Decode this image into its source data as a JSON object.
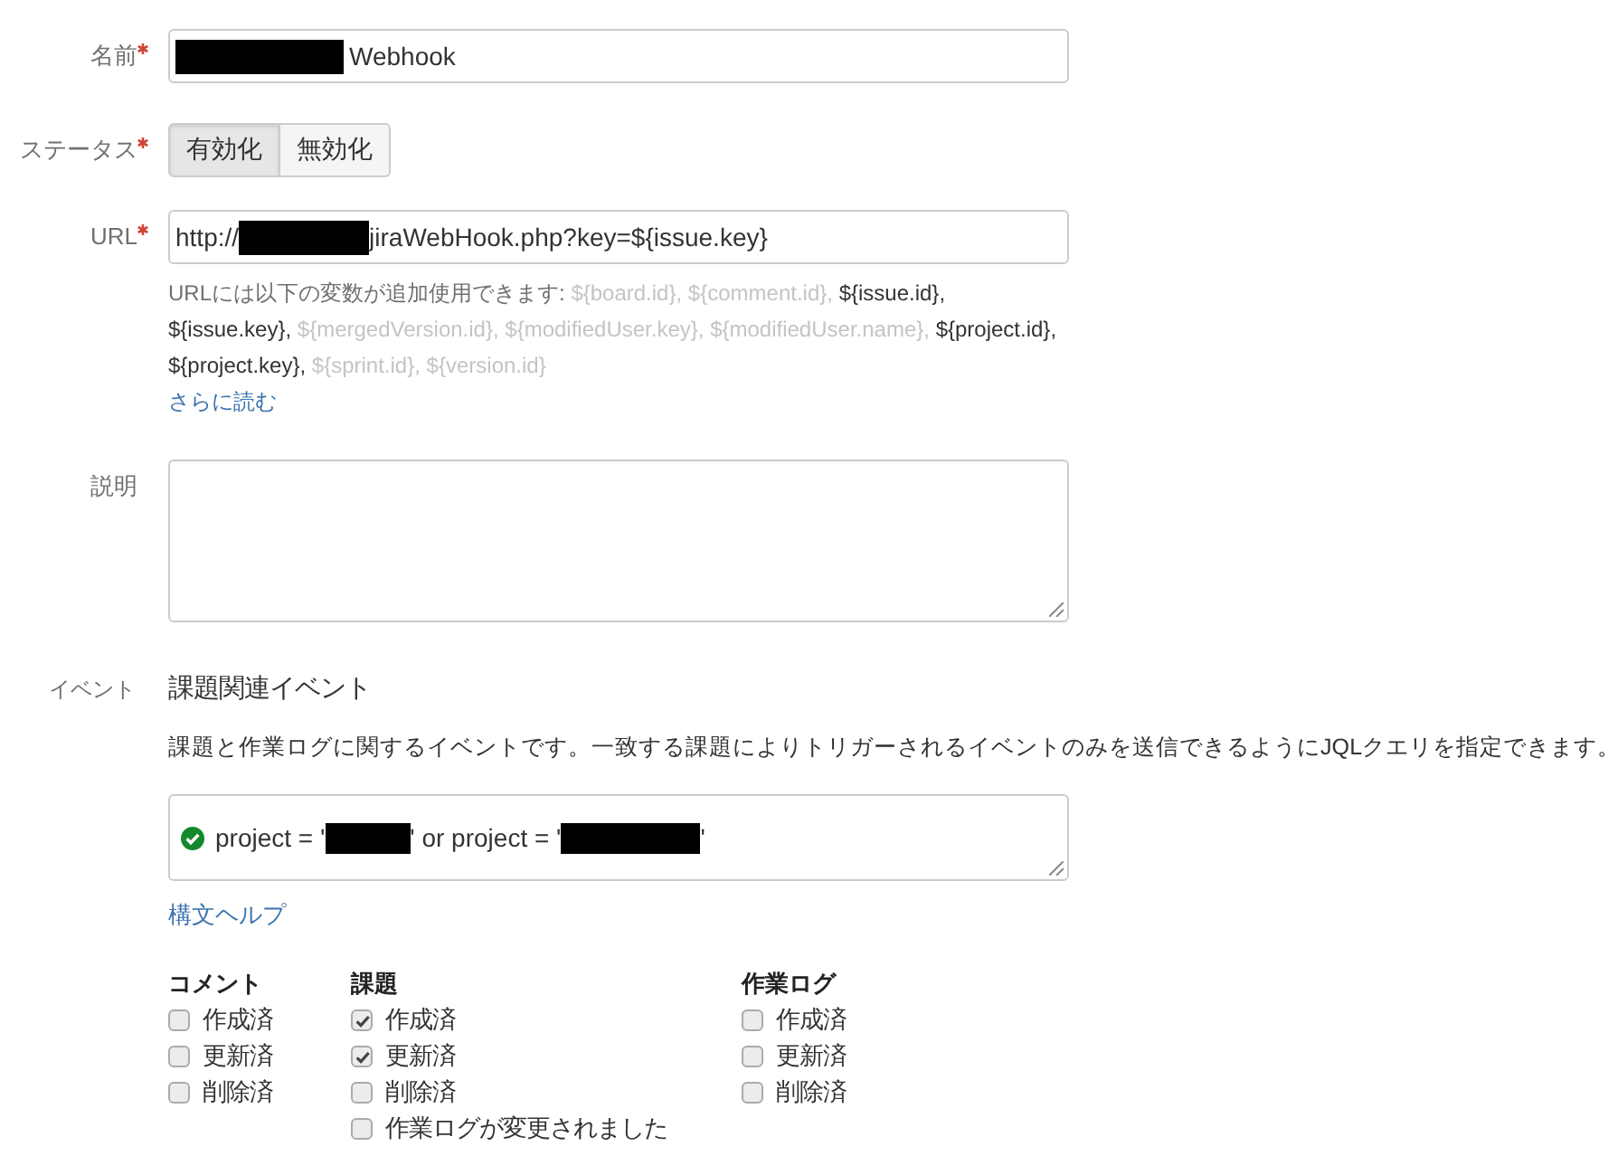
{
  "name_field": {
    "label": "名前",
    "required": true,
    "value_parts": [
      {
        "kind": "redacted"
      },
      {
        "kind": "text",
        "text": "Webhook"
      }
    ]
  },
  "status_field": {
    "label": "ステータス",
    "required": true,
    "options": [
      {
        "label": "有効化",
        "selected": true
      },
      {
        "label": "無効化",
        "selected": false
      }
    ]
  },
  "url_field": {
    "label": "URL",
    "required": true,
    "value_parts": [
      {
        "kind": "text",
        "text": "http://"
      },
      {
        "kind": "redacted"
      },
      {
        "kind": "text",
        "text": "jiraWebHook.php?key=${issue.key}"
      }
    ],
    "help": {
      "intro": "URLには以下の変数が追加使用できます:",
      "variables": [
        {
          "text": "${board.id},",
          "used": false
        },
        {
          "text": "${comment.id},",
          "used": false
        },
        {
          "text": "${issue.id},",
          "used": true
        },
        {
          "text": "${issue.key},",
          "used": true
        },
        {
          "text": "${mergedVersion.id},",
          "used": false
        },
        {
          "text": "${modifiedUser.key},",
          "used": false
        },
        {
          "text": "${modifiedUser.name},",
          "used": false
        },
        {
          "text": "${project.id},",
          "used": true
        },
        {
          "text": "${project.key},",
          "used": true
        },
        {
          "text": "${sprint.id},",
          "used": false
        },
        {
          "text": "${version.id}",
          "used": false
        }
      ],
      "link": "さらに読む"
    }
  },
  "description_field": {
    "label": "説明",
    "required": false
  },
  "events": {
    "label": "イベント",
    "title": "課題関連イベント",
    "description": "課題と作業ログに関するイベントです。一致する課題によりトリガーされるイベントのみを送信できるようにJQLクエリを指定できます。",
    "jql": {
      "valid": true,
      "value_parts": [
        {
          "kind": "text",
          "text": "project = '"
        },
        {
          "kind": "redacted"
        },
        {
          "kind": "text",
          "text": "' or project = '"
        },
        {
          "kind": "redacted"
        },
        {
          "kind": "text",
          "text": "'"
        }
      ]
    },
    "help_link": "構文ヘルプ",
    "groups": [
      {
        "title": "コメント",
        "options": [
          {
            "label": "作成済",
            "checked": false
          },
          {
            "label": "更新済",
            "checked": false
          },
          {
            "label": "削除済",
            "checked": false
          }
        ]
      },
      {
        "title": "課題",
        "options": [
          {
            "label": "作成済",
            "checked": true
          },
          {
            "label": "更新済",
            "checked": true
          },
          {
            "label": "削除済",
            "checked": false
          },
          {
            "label": "作業ログが変更されました",
            "checked": false
          }
        ]
      },
      {
        "title": "作業ログ",
        "options": [
          {
            "label": "作成済",
            "checked": false
          },
          {
            "label": "更新済",
            "checked": false
          },
          {
            "label": "削除済",
            "checked": false
          }
        ]
      }
    ]
  }
}
